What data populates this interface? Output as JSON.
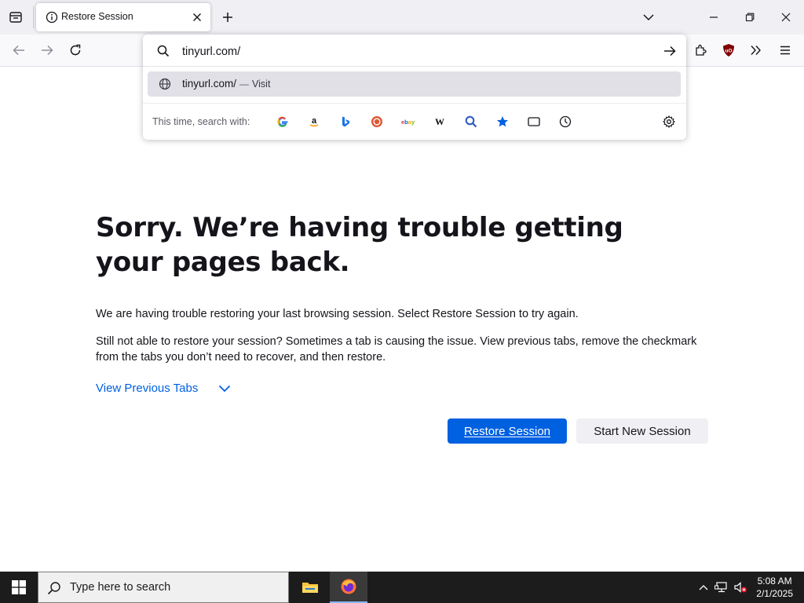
{
  "tab": {
    "title": "Restore Session"
  },
  "urlbar": {
    "value": "tinyurl.com/",
    "suggestion_text": "tinyurl.com/",
    "suggestion_sep": "—",
    "suggestion_action": "Visit",
    "search_with_label": "This time, search with:",
    "engines": [
      "google-icon",
      "amazon-icon",
      "bing-icon",
      "duckduckgo-icon",
      "ebay-icon",
      "wikipedia-icon",
      "search-icon",
      "bookmarks-star-icon",
      "tabs-icon",
      "history-icon"
    ]
  },
  "content": {
    "heading": "Sorry. We’re having trouble getting your pages back.",
    "para1": "We are having trouble restoring your last browsing session. Select Restore Session to try again.",
    "para2": "Still not able to restore your session? Sometimes a tab is causing the issue. View previous tabs, remove the checkmark from the tabs you don’t need to recover, and then restore.",
    "view_previous_tabs": "View Previous Tabs",
    "restore_button": "Restore Session",
    "new_session_button": "Start New Session"
  },
  "taskbar": {
    "search_placeholder": "Type here to search",
    "time": "5:08 AM",
    "date": "2/1/2025"
  },
  "colors": {
    "accent": "#0061e0",
    "tabstrip_bg": "#f0f0f4",
    "taskbar_bg": "#1c1c1c"
  }
}
